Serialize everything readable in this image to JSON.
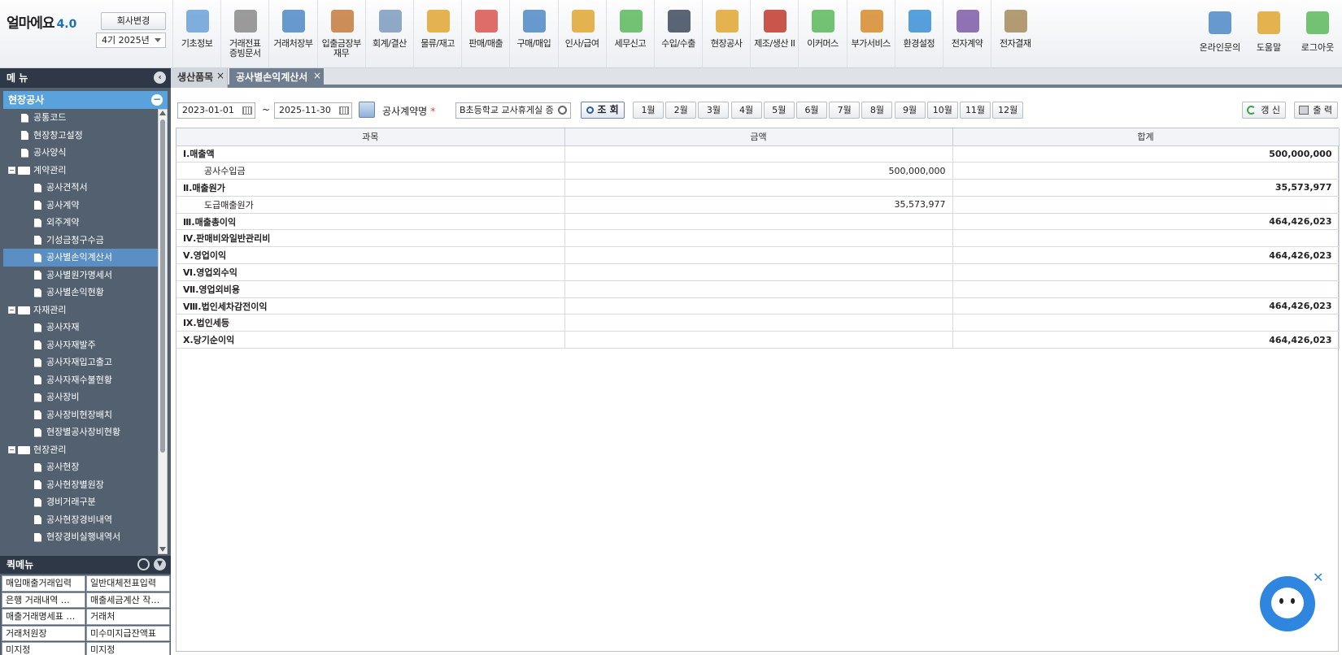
{
  "app": {
    "logo": "얼마에요",
    "version": "4.0",
    "company_button": "회사변경",
    "period": "4기 2025년"
  },
  "modules": [
    {
      "label": "기초정보",
      "icon": "basic-info-icon"
    },
    {
      "label": "거래전표\n증빙문서",
      "icon": "voucher-icon"
    },
    {
      "label": "거래처장부",
      "icon": "ledger-icon"
    },
    {
      "label": "입출금장부\n재무",
      "icon": "cash-ledger-icon"
    },
    {
      "label": "회계/결산",
      "icon": "accounting-icon"
    },
    {
      "label": "물류/재고",
      "icon": "inventory-icon"
    },
    {
      "label": "판매/매출",
      "icon": "sales-icon"
    },
    {
      "label": "구매/매입",
      "icon": "purchase-icon"
    },
    {
      "label": "인사/급여",
      "icon": "hr-icon"
    },
    {
      "label": "세무신고",
      "icon": "tax-icon"
    },
    {
      "label": "수입/수출",
      "icon": "import-export-icon"
    },
    {
      "label": "현장공사",
      "icon": "construction-icon"
    },
    {
      "label": "제조/생산 II",
      "icon": "manufacturing-icon"
    },
    {
      "label": "이커머스",
      "icon": "ecommerce-icon"
    },
    {
      "label": "부가서비스",
      "icon": "addon-service-icon"
    },
    {
      "label": "환경설정",
      "icon": "settings-gear-icon"
    },
    {
      "label": "전자계약",
      "icon": "e-contract-icon"
    },
    {
      "label": "전자결재",
      "icon": "e-approval-icon"
    }
  ],
  "utilities": [
    {
      "label": "온라인문의",
      "icon": "online-inquiry-icon"
    },
    {
      "label": "도움말",
      "icon": "help-book-icon"
    },
    {
      "label": "로그아웃",
      "icon": "logout-icon"
    }
  ],
  "sidebar": {
    "menu_title": "메 뉴",
    "section_title": "현장공사",
    "tree": [
      {
        "label": "공통코드",
        "level": 1,
        "type": "doc"
      },
      {
        "label": "현장창고설정",
        "level": 1,
        "type": "doc"
      },
      {
        "label": "공사양식",
        "level": 1,
        "type": "doc"
      },
      {
        "label": "계약관리",
        "level": 0,
        "type": "folder"
      },
      {
        "label": "공사견적서",
        "level": 2,
        "type": "doc"
      },
      {
        "label": "공사계약",
        "level": 2,
        "type": "doc"
      },
      {
        "label": "외주계약",
        "level": 2,
        "type": "doc"
      },
      {
        "label": "기성금청구수금",
        "level": 2,
        "type": "doc"
      },
      {
        "label": "공사별손익계산서",
        "level": 2,
        "type": "doc",
        "active": true
      },
      {
        "label": "공사별원가명세서",
        "level": 2,
        "type": "doc"
      },
      {
        "label": "공사별손익현황",
        "level": 2,
        "type": "doc"
      },
      {
        "label": "자재관리",
        "level": 0,
        "type": "folder"
      },
      {
        "label": "공사자재",
        "level": 2,
        "type": "doc"
      },
      {
        "label": "공사자재발주",
        "level": 2,
        "type": "doc"
      },
      {
        "label": "공사자재입고출고",
        "level": 2,
        "type": "doc"
      },
      {
        "label": "공사자재수불현황",
        "level": 2,
        "type": "doc"
      },
      {
        "label": "공사장비",
        "level": 2,
        "type": "doc"
      },
      {
        "label": "공사장비현장배치",
        "level": 2,
        "type": "doc"
      },
      {
        "label": "현장별공사장비현황",
        "level": 2,
        "type": "doc"
      },
      {
        "label": "현장관리",
        "level": 0,
        "type": "folder"
      },
      {
        "label": "공사현장",
        "level": 2,
        "type": "doc"
      },
      {
        "label": "공사현장별원장",
        "level": 2,
        "type": "doc"
      },
      {
        "label": "경비거래구분",
        "level": 2,
        "type": "doc"
      },
      {
        "label": "공사현장경비내역",
        "level": 2,
        "type": "doc"
      },
      {
        "label": "현장경비실행내역서",
        "level": 2,
        "type": "doc"
      }
    ],
    "quick_title": "퀵메뉴",
    "quick_items": [
      "매입매출거래입력",
      "일반대체전표입력",
      "은행 거래내역 …",
      "매출세금계산 작…",
      "매출거래명세표 …",
      "거래처",
      "거래처원장",
      "미수미지급잔액표",
      "미지정",
      "미지정"
    ]
  },
  "tabs": [
    {
      "label": "생산품목"
    },
    {
      "label": "공사별손익계산서"
    }
  ],
  "toolbar": {
    "date_from": "2023-01-01",
    "tilde": "~",
    "date_to": "2025-11-30",
    "contract_label": "공사계약명",
    "required_mark": "*",
    "contract_value": "B초등학교 교사휴게실 증",
    "search_label": "조 회",
    "months": [
      "1월",
      "2월",
      "3월",
      "4월",
      "5월",
      "6월",
      "7월",
      "8월",
      "9월",
      "10월",
      "11월",
      "12월"
    ],
    "refresh_label": "갱 신",
    "print_label": "출 력"
  },
  "grid": {
    "headers": [
      "과목",
      "금액",
      "합계"
    ],
    "rows": [
      {
        "subject": "Ⅰ.매출액",
        "amount": "",
        "total": "500,000,000",
        "major": true
      },
      {
        "subject": "공사수입금",
        "amount": "500,000,000",
        "total": "",
        "major": false
      },
      {
        "subject": "Ⅱ.매출원가",
        "amount": "",
        "total": "35,573,977",
        "major": true
      },
      {
        "subject": "도급매출원가",
        "amount": "35,573,977",
        "total": "",
        "major": false
      },
      {
        "subject": "Ⅲ.매출총이익",
        "amount": "",
        "total": "464,426,023",
        "major": true
      },
      {
        "subject": "Ⅳ.판매비와일반관리비",
        "amount": "",
        "total": "",
        "major": true
      },
      {
        "subject": "Ⅴ.영업이익",
        "amount": "",
        "total": "464,426,023",
        "major": true
      },
      {
        "subject": "Ⅵ.영업외수익",
        "amount": "",
        "total": "",
        "major": true
      },
      {
        "subject": "Ⅶ.영업외비용",
        "amount": "",
        "total": "",
        "major": true
      },
      {
        "subject": "Ⅷ.법인세차감전이익",
        "amount": "",
        "total": "464,426,023",
        "major": true
      },
      {
        "subject": "Ⅸ.법인세등",
        "amount": "",
        "total": "",
        "major": true
      },
      {
        "subject": "Ⅹ.당기순이익",
        "amount": "",
        "total": "464,426,023",
        "major": true
      }
    ]
  },
  "chatbot": {
    "icon": "chatbot-bear-icon",
    "close": "✕"
  },
  "colors": {
    "sidebar_bg": "#52606f",
    "sidebar_header": "#2e3846",
    "section_blue": "#5aa2dc",
    "active_item": "#5b8fc4",
    "tab_active": "#6e7d8f",
    "chatbot_blue": "#2e86de"
  }
}
